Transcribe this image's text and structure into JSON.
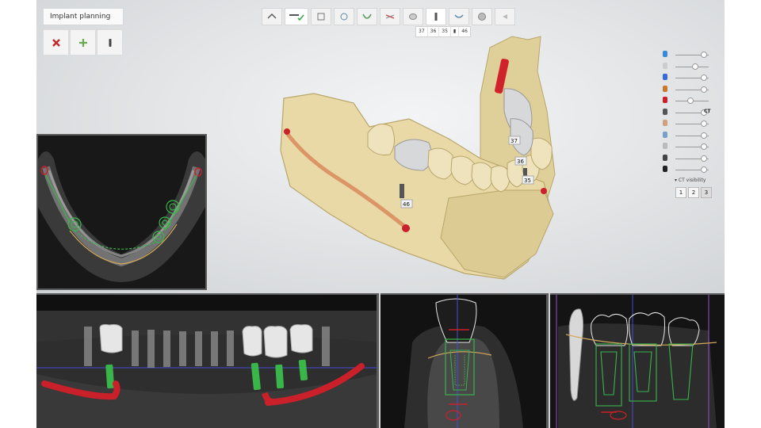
{
  "panel": {
    "title": "Implant planning",
    "buttons": [
      {
        "icon": "delete-x-icon",
        "color": "#c0282d"
      },
      {
        "icon": "add-plus-icon",
        "color": "#6aa84f"
      },
      {
        "icon": "implant-icon",
        "color": "#444444"
      }
    ]
  },
  "toolbar": {
    "buttons": [
      "home-icon",
      "bite-check-icon",
      "scan-icon",
      "tooth-settings-icon",
      "arch-icon",
      "crown-icon",
      "tooth-icon",
      "implant-icon",
      "guide-icon",
      "sphere-icon",
      "undo-icon"
    ]
  },
  "tooth_chips": [
    "37",
    "36",
    "35",
    "46"
  ],
  "tooth_labels": [
    "37",
    "36",
    "35",
    "46"
  ],
  "sidebar": {
    "ct_label": "CT",
    "ct_visibility": "CT visibility",
    "view_buttons": [
      "1",
      "2",
      "3"
    ],
    "active_view": "3",
    "slider_levels": [
      0.85,
      0.55,
      0.85,
      0.85,
      0.4,
      0.85,
      0.85,
      0.85,
      0.85,
      0.85,
      0.85
    ]
  },
  "colors": {
    "bone": "#e8d9a6",
    "nerve": "#c9202a",
    "implant_guide": "#39b54a",
    "crown": "#e6e6e6",
    "outline": "#d4a85a"
  }
}
